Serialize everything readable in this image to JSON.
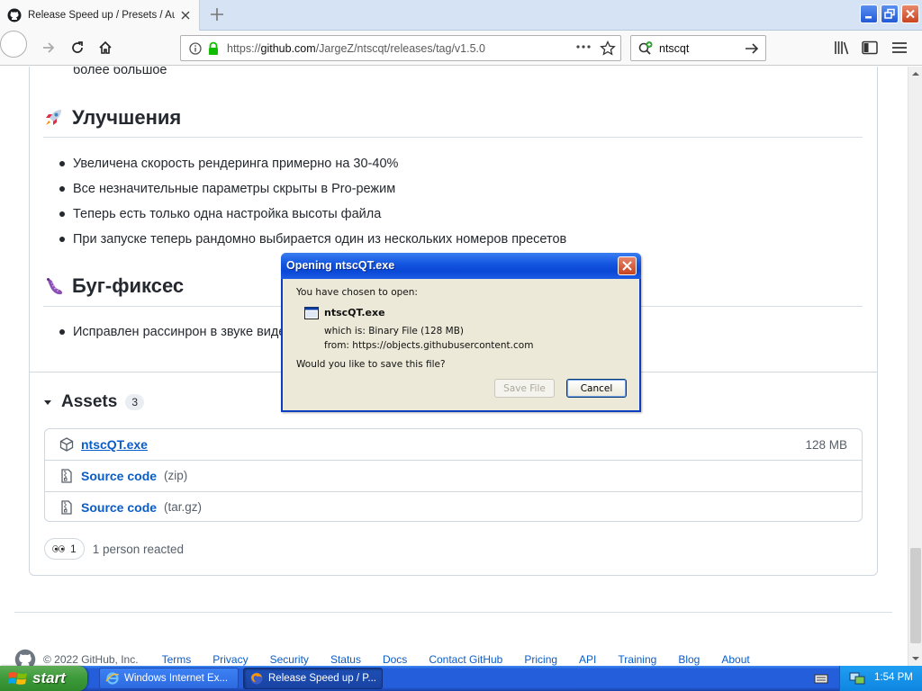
{
  "browser": {
    "tab_title": "Release Speed up / Presets / Audio",
    "url_prefix": "https://",
    "url_domain": "github.com",
    "url_path": "/JargeZ/ntscqt/releases/tag/v1.5.0",
    "search_value": "ntscqt"
  },
  "page": {
    "prev_text": "более большое",
    "improvements_heading": "Улучшения",
    "improvements": [
      "Увеличена скорость рендеринга примерно на 30-40%",
      "Все незначительные параметры скрыты в Pro-режим",
      "Теперь есть только одна настройка высоты файла",
      "При запуске теперь рандомно выбирается один из нескольких номеров пресетов"
    ],
    "bugfixes_heading": "Буг-фиксес",
    "bugfixes": [
      "Исправлен рассинрон в звуке видео"
    ],
    "assets": {
      "title": "Assets",
      "count": "3",
      "items": [
        {
          "name": "ntscQT.exe",
          "ext": "",
          "size": "128 MB"
        },
        {
          "name": "Source code",
          "ext": "(zip)",
          "size": ""
        },
        {
          "name": "Source code",
          "ext": "(tar.gz)",
          "size": ""
        }
      ]
    },
    "reactions": {
      "count": "1",
      "text": "1 person reacted"
    },
    "footer": {
      "copyright": "© 2022 GitHub, Inc.",
      "links": [
        "Terms",
        "Privacy",
        "Security",
        "Status",
        "Docs",
        "Contact GitHub",
        "Pricing",
        "API",
        "Training",
        "Blog",
        "About"
      ]
    }
  },
  "dialog": {
    "title": "Opening ntscQT.exe",
    "intro": "You have chosen to open:",
    "filename": "ntscQT.exe",
    "which_is": "which is:  Binary File (128 MB)",
    "from": "from:  https://objects.githubusercontent.com",
    "question": "Would you like to save this file?",
    "save_label": "Save File",
    "cancel_label": "Cancel"
  },
  "taskbar": {
    "start_label": "start",
    "tasks": [
      "Windows Internet Ex...",
      "Release Speed up / P..."
    ],
    "time": "1:54 PM"
  },
  "colors": {
    "link_blue": "#0a5dc8",
    "xp_titlebar": "#0a47d6",
    "xp_start_green": "#3c9a3a",
    "taskbar_blue": "#245edb"
  },
  "icons": {
    "tab": "github-icon",
    "improvements": "rocket-icon",
    "bugfixes": "bug-icon",
    "asset_exe": "package-icon",
    "asset_source": "file-zip-icon",
    "reaction": "eyes-icon"
  }
}
